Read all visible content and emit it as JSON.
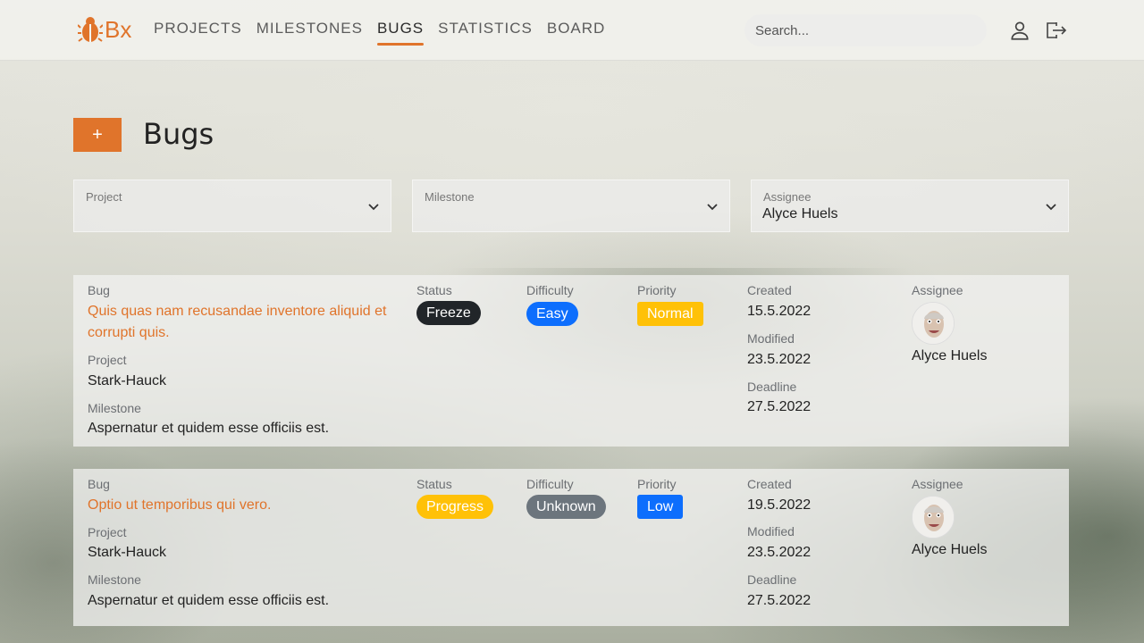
{
  "app": {
    "logo_text": "Bx",
    "brand_color": "#e0742b"
  },
  "nav": {
    "items": [
      {
        "label": "PROJECTS",
        "active": false
      },
      {
        "label": "MILESTONES",
        "active": false
      },
      {
        "label": "BUGS",
        "active": true
      },
      {
        "label": "STATISTICS",
        "active": false
      },
      {
        "label": "BOARD",
        "active": false
      }
    ],
    "search_placeholder": "Search...",
    "icons": [
      "user-icon",
      "logout-icon"
    ]
  },
  "page": {
    "title": "Bugs",
    "add_button_label": "+"
  },
  "filters": {
    "project": {
      "label": "Project",
      "value": ""
    },
    "milestone": {
      "label": "Milestone",
      "value": ""
    },
    "assignee": {
      "label": "Assignee",
      "value": "Alyce Huels"
    }
  },
  "labels": {
    "bug": "Bug",
    "project": "Project",
    "milestone": "Milestone",
    "status": "Status",
    "difficulty": "Difficulty",
    "priority": "Priority",
    "created": "Created",
    "modified": "Modified",
    "deadline": "Deadline",
    "assignee": "Assignee"
  },
  "bugs": [
    {
      "title": "Quis quas nam recusandae inventore aliquid et corrupti quis.",
      "project": "Stark-Hauck",
      "milestone": "Aspernatur et quidem esse officiis est.",
      "status": "Freeze",
      "status_color": "#212529",
      "difficulty": "Easy",
      "difficulty_color": "#0d6efd",
      "priority": "Normal",
      "priority_color": "#ffc107",
      "created": "15.5.2022",
      "modified": "23.5.2022",
      "deadline": "27.5.2022",
      "assignee": "Alyce Huels"
    },
    {
      "title": "Optio ut temporibus qui vero.",
      "project": "Stark-Hauck",
      "milestone": "Aspernatur et quidem esse officiis est.",
      "status": "Progress",
      "status_color": "#ffc107",
      "difficulty": "Unknown",
      "difficulty_color": "#6c757d",
      "priority": "Low",
      "priority_color": "#0d6efd",
      "created": "19.5.2022",
      "modified": "23.5.2022",
      "deadline": "27.5.2022",
      "assignee": "Alyce Huels"
    }
  ]
}
